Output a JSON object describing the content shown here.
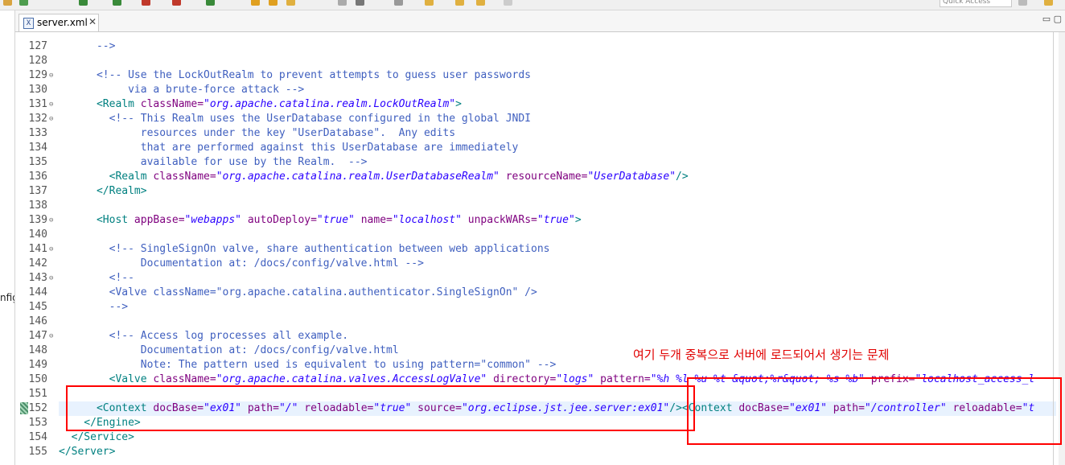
{
  "toolbar": {
    "quick_access_placeholder": "Quick Access"
  },
  "left_panel": {
    "fragment": "nfig"
  },
  "tab": {
    "icon_glyph": "X",
    "title": "server.xml",
    "close_glyph": "✕"
  },
  "window": {
    "minmax_glyphs": "▭ ▢"
  },
  "annotation": {
    "text": "여기 두개 중복으로 서버에 로드되어서 생기는 문제"
  },
  "colors": {
    "comment": "#3f5fbf",
    "tag": "#008080",
    "attribute": "#7f007f",
    "value": "#2a00ff",
    "annotation": "#ff0000"
  },
  "lines": [
    {
      "n": "127",
      "fold": false,
      "seg": [
        [
          "cm",
          "      -->"
        ]
      ]
    },
    {
      "n": "128",
      "fold": false,
      "seg": []
    },
    {
      "n": "129",
      "fold": true,
      "seg": [
        [
          "cm",
          "      <!-- Use the LockOutRealm to prevent attempts to guess user passwords"
        ]
      ]
    },
    {
      "n": "130",
      "fold": false,
      "seg": [
        [
          "cm",
          "           via a brute-force attack -->"
        ]
      ]
    },
    {
      "n": "131",
      "fold": true,
      "seg": [
        [
          "tg",
          "      <Realm "
        ],
        [
          "at",
          "className="
        ],
        [
          "av",
          "\"org.apache.catalina.realm.LockOutRealm\""
        ],
        [
          "tg",
          ">"
        ]
      ]
    },
    {
      "n": "132",
      "fold": true,
      "seg": [
        [
          "cm",
          "        <!-- This Realm uses the UserDatabase configured in the global JNDI"
        ]
      ]
    },
    {
      "n": "133",
      "fold": false,
      "seg": [
        [
          "cm",
          "             resources under the key \"UserDatabase\".  Any edits"
        ]
      ]
    },
    {
      "n": "134",
      "fold": false,
      "seg": [
        [
          "cm",
          "             that are performed against this UserDatabase are immediately"
        ]
      ]
    },
    {
      "n": "135",
      "fold": false,
      "seg": [
        [
          "cm",
          "             available for use by the Realm.  -->"
        ]
      ]
    },
    {
      "n": "136",
      "fold": false,
      "seg": [
        [
          "tg",
          "        <Realm "
        ],
        [
          "at",
          "className="
        ],
        [
          "av",
          "\"org.apache.catalina.realm.UserDatabaseRealm\""
        ],
        [
          "tg",
          " "
        ],
        [
          "at",
          "resourceName="
        ],
        [
          "av",
          "\"UserDatabase\""
        ],
        [
          "tg",
          "/>"
        ]
      ]
    },
    {
      "n": "137",
      "fold": false,
      "seg": [
        [
          "tg",
          "      </Realm>"
        ]
      ]
    },
    {
      "n": "138",
      "fold": false,
      "seg": []
    },
    {
      "n": "139",
      "fold": true,
      "seg": [
        [
          "tg",
          "      <Host "
        ],
        [
          "at",
          "appBase="
        ],
        [
          "av",
          "\"webapps\""
        ],
        [
          "tg",
          " "
        ],
        [
          "at",
          "autoDeploy="
        ],
        [
          "av",
          "\"true\""
        ],
        [
          "tg",
          " "
        ],
        [
          "at",
          "name="
        ],
        [
          "av",
          "\"localhost\""
        ],
        [
          "tg",
          " "
        ],
        [
          "at",
          "unpackWARs="
        ],
        [
          "av",
          "\"true\""
        ],
        [
          "tg",
          ">"
        ]
      ]
    },
    {
      "n": "140",
      "fold": false,
      "seg": []
    },
    {
      "n": "141",
      "fold": true,
      "seg": [
        [
          "cm",
          "        <!-- SingleSignOn valve, share authentication between web applications"
        ]
      ]
    },
    {
      "n": "142",
      "fold": false,
      "seg": [
        [
          "cm",
          "             Documentation at: /docs/config/valve.html -->"
        ]
      ]
    },
    {
      "n": "143",
      "fold": true,
      "seg": [
        [
          "cm",
          "        <!--"
        ]
      ]
    },
    {
      "n": "144",
      "fold": false,
      "seg": [
        [
          "cm",
          "        <Valve className=\"org.apache.catalina.authenticator.SingleSignOn\" />"
        ]
      ]
    },
    {
      "n": "145",
      "fold": false,
      "seg": [
        [
          "cm",
          "        -->"
        ]
      ]
    },
    {
      "n": "146",
      "fold": false,
      "seg": []
    },
    {
      "n": "147",
      "fold": true,
      "seg": [
        [
          "cm",
          "        <!-- Access log processes all example."
        ]
      ]
    },
    {
      "n": "148",
      "fold": false,
      "seg": [
        [
          "cm",
          "             Documentation at: /docs/config/valve.html"
        ]
      ]
    },
    {
      "n": "149",
      "fold": false,
      "seg": [
        [
          "cm",
          "             Note: The pattern used is equivalent to using pattern=\"common\" -->"
        ]
      ]
    },
    {
      "n": "150",
      "fold": false,
      "seg": [
        [
          "tg",
          "        <Valve "
        ],
        [
          "at",
          "className="
        ],
        [
          "av",
          "\"org.apache.catalina.valves.AccessLogValve\""
        ],
        [
          "tg",
          " "
        ],
        [
          "at",
          "directory="
        ],
        [
          "av",
          "\"logs\""
        ],
        [
          "tg",
          " "
        ],
        [
          "at",
          "pattern="
        ],
        [
          "av",
          "\"%h %l %u %t &quot;%r&quot; %s %b\""
        ],
        [
          "tg",
          " "
        ],
        [
          "at",
          "prefix="
        ],
        [
          "av",
          "\"localhost_access_l"
        ]
      ]
    },
    {
      "n": "151",
      "fold": false,
      "seg": []
    },
    {
      "n": "152",
      "fold": false,
      "seg": [
        [
          "tg",
          "      <Context "
        ],
        [
          "at",
          "docBase="
        ],
        [
          "av",
          "\"ex01\""
        ],
        [
          "tg",
          " "
        ],
        [
          "at",
          "path="
        ],
        [
          "av",
          "\"/\""
        ],
        [
          "tg",
          " "
        ],
        [
          "at",
          "reloadable="
        ],
        [
          "av",
          "\"true\""
        ],
        [
          "tg",
          " "
        ],
        [
          "at",
          "source="
        ],
        [
          "av",
          "\"org.eclipse.jst.jee.server:ex01\""
        ],
        [
          "tg",
          "/><Context "
        ],
        [
          "at",
          "docBase="
        ],
        [
          "av",
          "\"ex01\""
        ],
        [
          "tg",
          " "
        ],
        [
          "at",
          "path="
        ],
        [
          "av",
          "\"/controller\""
        ],
        [
          "tg",
          " "
        ],
        [
          "at",
          "reloadable="
        ],
        [
          "av",
          "\"t"
        ]
      ]
    },
    {
      "n": "153",
      "fold": false,
      "seg": [
        [
          "tg",
          "    </Engine>"
        ]
      ]
    },
    {
      "n": "154",
      "fold": false,
      "seg": [
        [
          "tg",
          "  </Service>"
        ]
      ]
    },
    {
      "n": "155",
      "fold": false,
      "seg": [
        [
          "tg",
          "</Server>"
        ]
      ]
    }
  ]
}
